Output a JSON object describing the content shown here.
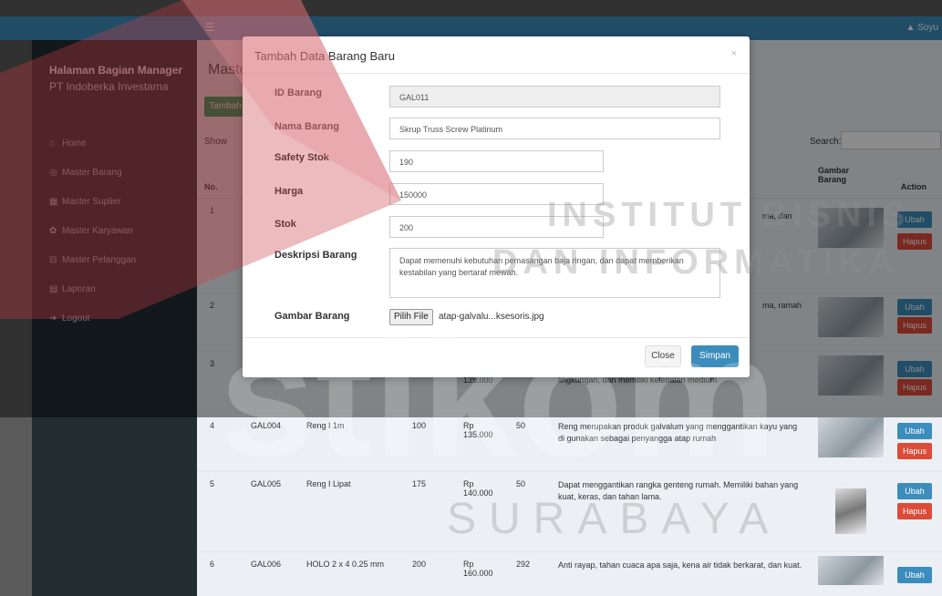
{
  "topbar": {
    "menu_icon": "☰",
    "user_label": "▲ Soyu"
  },
  "sidebar": {
    "brand": "Halaman Bagian Manager",
    "company": "PT Indoberka Investama",
    "items": [
      {
        "icon": "home-icon",
        "label": "Home"
      },
      {
        "icon": "box-icon",
        "label": "Master Barang"
      },
      {
        "icon": "table-icon",
        "label": "Master Suplier"
      },
      {
        "icon": "gear-icon",
        "label": "Master Karyawan"
      },
      {
        "icon": "cart-icon",
        "label": "Master Pelanggan"
      },
      {
        "icon": "report-icon",
        "label": "Laporan"
      },
      {
        "icon": "logout-icon",
        "label": "Logout"
      }
    ]
  },
  "content": {
    "page_title": "Maste",
    "add_label": "Tambah",
    "show_label": "Show",
    "search_label": "Search:",
    "columns": {
      "no": "No.",
      "gambar": "Gambar Barang",
      "action": "Action"
    },
    "rows": [
      {
        "no": "1",
        "id": "",
        "nama": "",
        "safety": "",
        "harga": "",
        "stok": "",
        "desc": "ma, dan",
        "ubah": "Ubah",
        "hapus": "Hapus"
      },
      {
        "no": "2",
        "id": "",
        "nama": "",
        "safety": "",
        "harga": "",
        "stok": "",
        "desc": "ma, ramah",
        "ubah": "Ubah",
        "hapus": "Hapus"
      },
      {
        "no": "3",
        "id": "",
        "nama": "",
        "safety": "",
        "harga": "135.000",
        "stok": "",
        "desc": "lingkungan, dan memiliki kelebalan medium",
        "ubah": "Ubah",
        "hapus": "Hapus"
      },
      {
        "no": "4",
        "id": "GAL004",
        "nama": "Reng I 1m",
        "safety": "100",
        "harga": "Rp 135.000",
        "stok": "50",
        "desc": "Reng merupakan produk galvalum yang menggantikan kayu yang di gunakan sebagai penyangga atap rumah",
        "ubah": "Ubah",
        "hapus": "Hapus"
      },
      {
        "no": "5",
        "id": "GAL005",
        "nama": "Reng I Lipat",
        "safety": "175",
        "harga": "Rp 140.000",
        "stok": "50",
        "desc": "Dapat menggantikan rangka genteng rumah. Memiliki bahan yang kuat, keras, dan tahan lama.",
        "ubah": "Ubah",
        "hapus": "Hapus"
      },
      {
        "no": "6",
        "id": "GAL006",
        "nama": "HOLO 2 x 4 0.25 mm",
        "safety": "200",
        "harga": "Rp 160.000",
        "stok": "292",
        "desc": "Anti rayap, tahan cuaca apa saja, kena air tidak berkarat, dan kuat.",
        "ubah": "Ubah",
        "hapus": ""
      }
    ]
  },
  "modal": {
    "title": "Tambah Data Barang Baru",
    "close_icon": "×",
    "fields": {
      "id_label": "ID Barang",
      "id_value": "GAL011",
      "nama_label": "Nama Barang",
      "nama_value": "Skrup Truss Screw Platinum",
      "safety_label": "Safety Stok",
      "safety_value": "190",
      "harga_label": "Harga",
      "harga_value": "150000",
      "stok_label": "Stok",
      "stok_value": "200",
      "desc_label": "Deskripsi Barang",
      "desc_value": "Dapat memenuhi kebutuhan pemasangan baja ringan, dan dapat memberikan kestabilan yang bertaraf mewah.",
      "gambar_label": "Gambar Barang",
      "file_button": "Pilih File",
      "file_name": "atap-galvalu...ksesoris.jpg"
    },
    "close_label": "Close",
    "save_label": "Simpan"
  },
  "watermark": {
    "line1": "INSTITUT BISNIS",
    "line2": "DAN INFORMATIKA",
    "brand": "stikom",
    "city": "SURABAYA"
  }
}
